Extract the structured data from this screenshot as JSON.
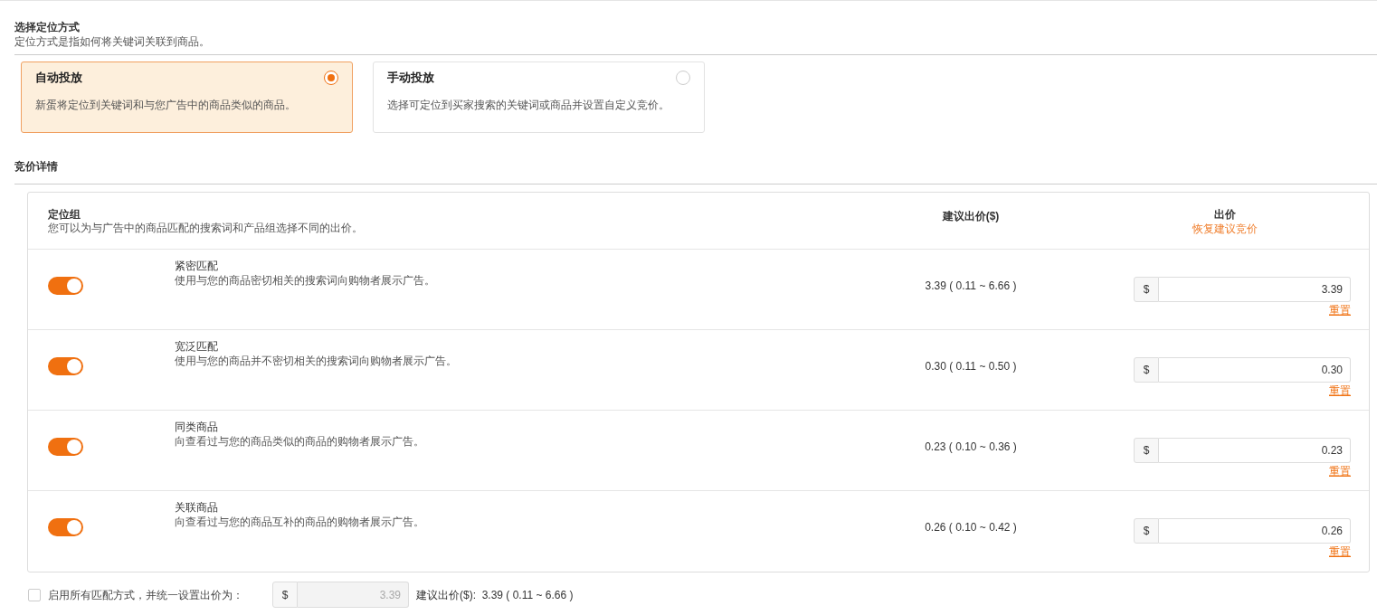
{
  "targeting": {
    "title": "选择定位方式",
    "description": "定位方式是指如何将关键词关联到商品。",
    "options": [
      {
        "label": "自动投放",
        "description": "新蛋将定位到关键词和与您广告中的商品类似的商品。",
        "selected": true
      },
      {
        "label": "手动投放",
        "description": "选择可定位到买家搜索的关键词或商品并设置自定义竞价。",
        "selected": false
      }
    ]
  },
  "bidding": {
    "title": "竞价详情",
    "table": {
      "group_header": {
        "title": "定位组",
        "description": "您可以为与广告中的商品匹配的搜索词和产品组选择不同的出价。"
      },
      "suggested_header": "建议出价($)",
      "bid_header": {
        "title": "出价",
        "restore_link": "恢复建议竞价"
      },
      "rows": [
        {
          "on": true,
          "name": "紧密匹配",
          "description": "使用与您的商品密切相关的搜索词向购物者展示广告。",
          "suggested": "3.39 ( 0.11 ~ 6.66 )",
          "currency": "$",
          "bid": "3.39",
          "reset": "重置"
        },
        {
          "on": true,
          "name": "宽泛匹配",
          "description": "使用与您的商品并不密切相关的搜索词向购物者展示广告。",
          "suggested": "0.30 ( 0.11 ~ 0.50 )",
          "currency": "$",
          "bid": "0.30",
          "reset": "重置"
        },
        {
          "on": true,
          "name": "同类商品",
          "description": "向查看过与您的商品类似的商品的购物者展示广告。",
          "suggested": "0.23 ( 0.10 ~ 0.36 )",
          "currency": "$",
          "bid": "0.23",
          "reset": "重置"
        },
        {
          "on": true,
          "name": "关联商品",
          "description": "向查看过与您的商品互补的商品的购物者展示广告。",
          "suggested": "0.26 ( 0.10 ~ 0.42 )",
          "currency": "$",
          "bid": "0.26",
          "reset": "重置"
        }
      ]
    },
    "uniform": {
      "checked": false,
      "label": "启用所有匹配方式，并统一设置出价为：",
      "currency": "$",
      "bid": "3.39",
      "disabled": true,
      "suggested": "建议出价($):  3.39 ( 0.11 ~ 6.66 )"
    }
  }
}
